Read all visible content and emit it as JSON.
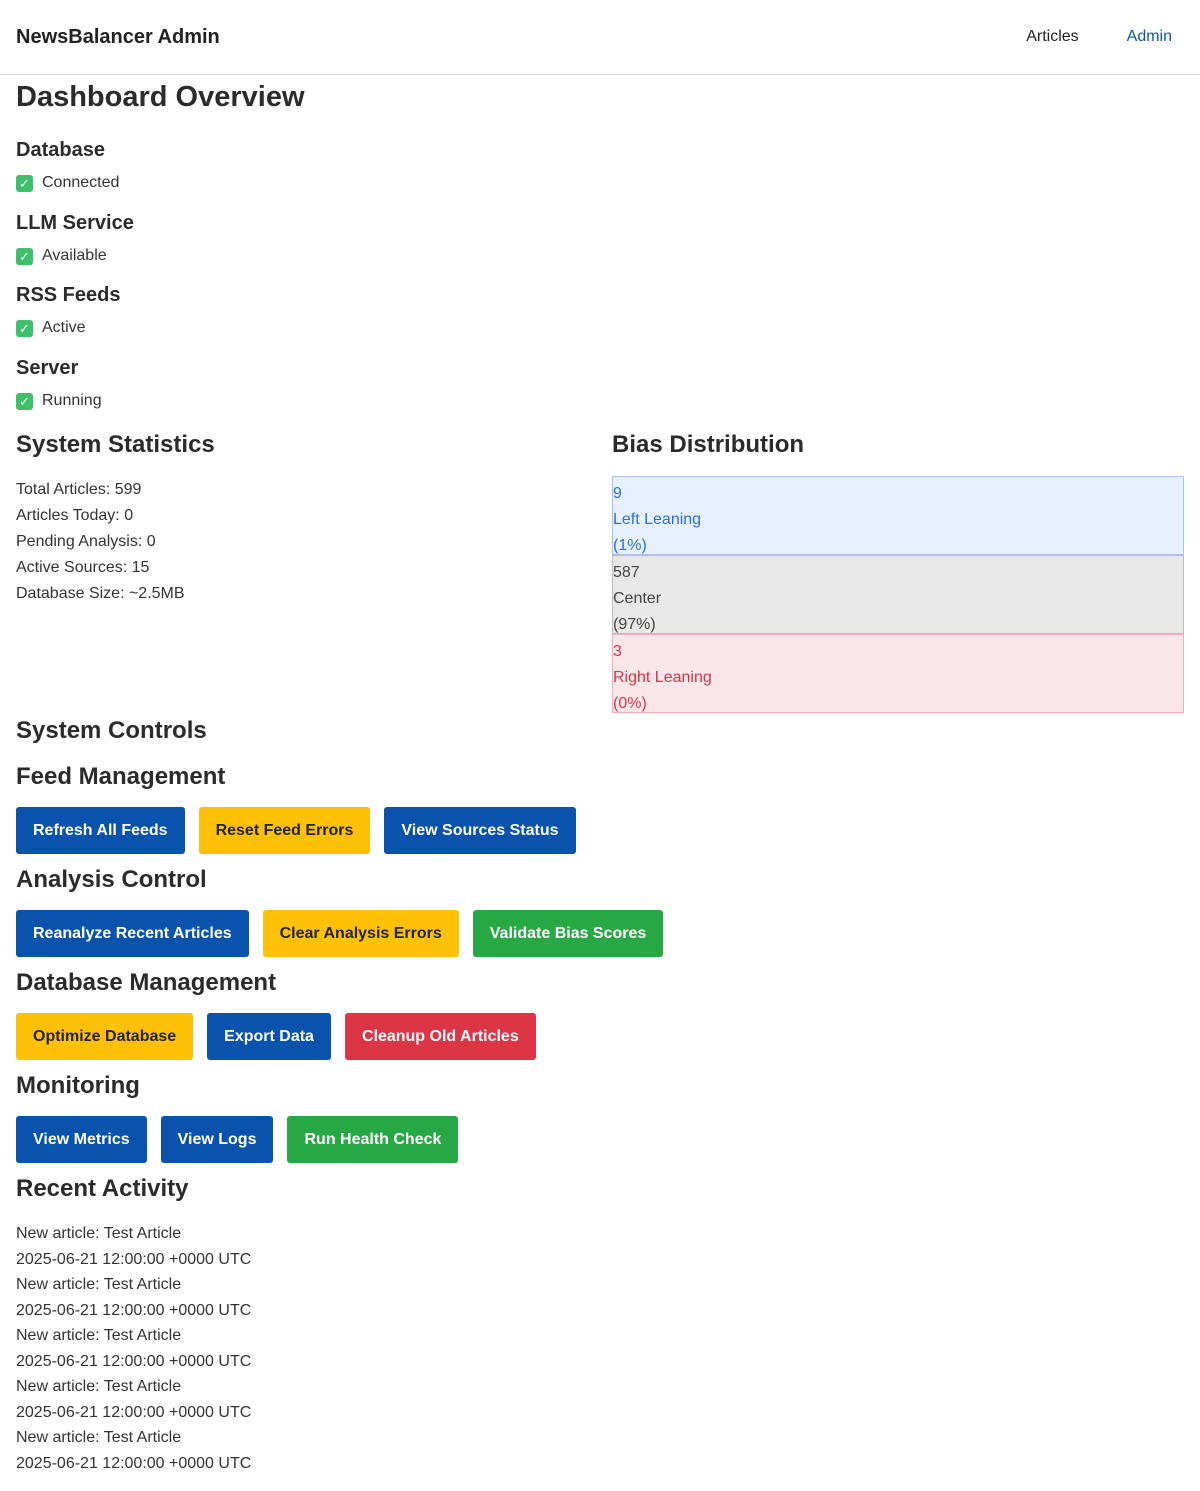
{
  "nav": {
    "brand": "NewsBalancer Admin",
    "links": [
      {
        "label": "Articles",
        "active": false
      },
      {
        "label": "Admin",
        "active": true
      }
    ]
  },
  "page": {
    "title": "Dashboard Overview"
  },
  "status": [
    {
      "title": "Database",
      "value": "Connected"
    },
    {
      "title": "LLM Service",
      "value": "Available"
    },
    {
      "title": "RSS Feeds",
      "value": "Active"
    },
    {
      "title": "Server",
      "value": "Running"
    }
  ],
  "stats": {
    "title": "System Statistics",
    "lines": [
      "Total Articles: 599",
      "Articles Today: 0",
      "Pending Analysis: 0",
      "Active Sources: 15",
      "Database Size: ~2.5MB"
    ]
  },
  "bias": {
    "title": "Bias Distribution",
    "rows": [
      {
        "count": "9",
        "label": "Left Leaning",
        "pct": "(1%)"
      },
      {
        "count": "587",
        "label": "Center",
        "pct": "(97%)"
      },
      {
        "count": "3",
        "label": "Right Leaning",
        "pct": "(0%)"
      }
    ]
  },
  "controls": {
    "title": "System Controls",
    "groups": [
      {
        "title": "Feed Management",
        "buttons": [
          "Refresh All Feeds",
          "Reset Feed Errors",
          "View Sources Status"
        ]
      },
      {
        "title": "Analysis Control",
        "buttons": [
          "Reanalyze Recent Articles",
          "Clear Analysis Errors",
          "Validate Bias Scores"
        ]
      },
      {
        "title": "Database Management",
        "buttons": [
          "Optimize Database",
          "Export Data",
          "Cleanup Old Articles"
        ]
      },
      {
        "title": "Monitoring",
        "buttons": [
          "View Metrics",
          "View Logs",
          "Run Health Check"
        ]
      }
    ]
  },
  "activity": {
    "title": "Recent Activity",
    "items": [
      {
        "text": "New article: Test Article",
        "time": "2025-06-21 12:00:00 +0000 UTC"
      },
      {
        "text": "New article: Test Article",
        "time": "2025-06-21 12:00:00 +0000 UTC"
      },
      {
        "text": "New article: Test Article",
        "time": "2025-06-21 12:00:00 +0000 UTC"
      },
      {
        "text": "New article: Test Article",
        "time": "2025-06-21 12:00:00 +0000 UTC"
      },
      {
        "text": "New article: Test Article",
        "time": "2025-06-21 12:00:00 +0000 UTC"
      }
    ]
  },
  "colors": {
    "primary": "#0a53ad",
    "warning": "#ffc107",
    "success": "#28a745",
    "danger": "#dc3545",
    "bias_left": "#2f6fd6",
    "bias_right": "#d4364a"
  },
  "icons": {
    "status": "check-icon"
  }
}
